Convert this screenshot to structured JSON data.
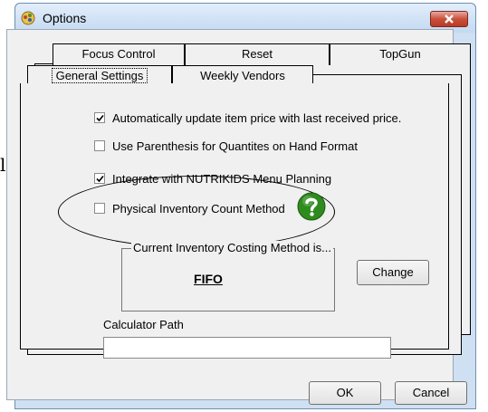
{
  "stray_text": "l",
  "window": {
    "title": "Options",
    "close_icon": "close-x-icon"
  },
  "tabs": {
    "back_row": [
      "Focus Control",
      "Reset",
      "TopGun"
    ],
    "front_row": [
      "General Settings",
      "Weekly Vendors"
    ],
    "selected": "General Settings"
  },
  "options": [
    {
      "label": "Automatically update item price with last received price.",
      "checked": true
    },
    {
      "label": "Use Parenthesis for Quantites on Hand Format",
      "checked": false
    },
    {
      "label": "Integrate with NUTRIKIDS Menu Planning",
      "checked": true
    },
    {
      "label": "Physical Inventory Count Method",
      "checked": false
    }
  ],
  "help_icon": "question-mark-icon",
  "costing": {
    "legend": "Current Inventory Costing Method is...",
    "value": "FIFO",
    "change_label": "Change"
  },
  "calculator": {
    "label": "Calculator Path",
    "value": ""
  },
  "buttons": {
    "ok": "OK",
    "cancel": "Cancel"
  },
  "colors": {
    "help_green": "#2e8b1e",
    "titlebar": "#d2e3f6",
    "close_red": "#c9503b"
  }
}
